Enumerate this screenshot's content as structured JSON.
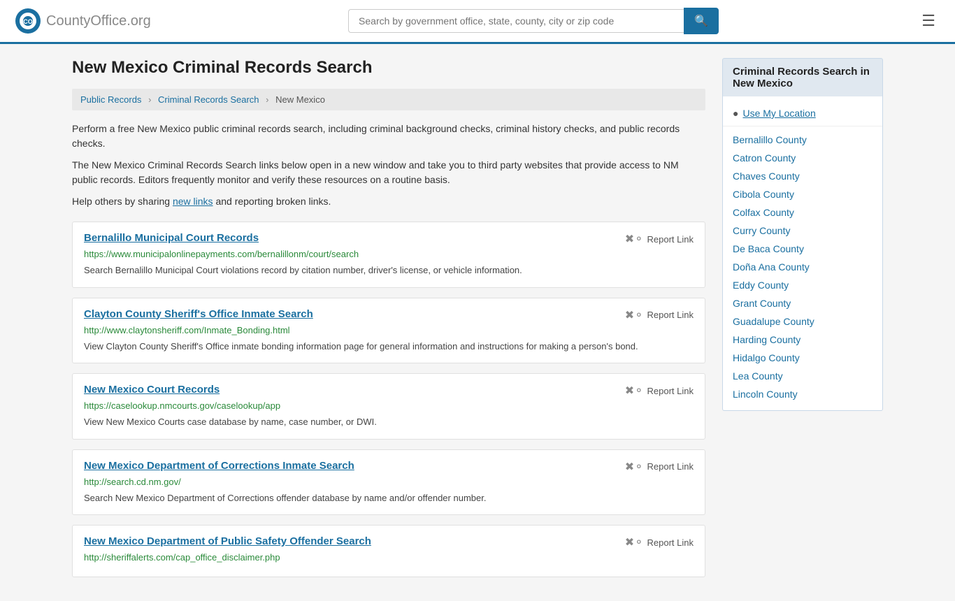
{
  "header": {
    "logo_text": "CountyOffice",
    "logo_suffix": ".org",
    "search_placeholder": "Search by government office, state, county, city or zip code",
    "search_value": ""
  },
  "page": {
    "title": "New Mexico Criminal Records Search",
    "breadcrumb": {
      "items": [
        "Public Records",
        "Criminal Records Search",
        "New Mexico"
      ]
    },
    "description1": "Perform a free New Mexico public criminal records search, including criminal background checks, criminal history checks, and public records checks.",
    "description2": "The New Mexico Criminal Records Search links below open in a new window and take you to third party websites that provide access to NM public records. Editors frequently monitor and verify these resources on a routine basis.",
    "description3_prefix": "Help others by sharing ",
    "description3_link": "new links",
    "description3_suffix": " and reporting broken links."
  },
  "records": [
    {
      "title": "Bernalillo Municipal Court Records",
      "url": "https://www.municipalonlinepayments.com/bernalillonm/court/search",
      "description": "Search Bernalillo Municipal Court violations record by citation number, driver's license, or vehicle information.",
      "report_label": "Report Link"
    },
    {
      "title": "Clayton County Sheriff's Office Inmate Search",
      "url": "http://www.claytonsheriff.com/Inmate_Bonding.html",
      "description": "View Clayton County Sheriff's Office inmate bonding information page for general information and instructions for making a person's bond.",
      "report_label": "Report Link"
    },
    {
      "title": "New Mexico Court Records",
      "url": "https://caselookup.nmcourts.gov/caselookup/app",
      "description": "View New Mexico Courts case database by name, case number, or DWI.",
      "report_label": "Report Link"
    },
    {
      "title": "New Mexico Department of Corrections Inmate Search",
      "url": "http://search.cd.nm.gov/",
      "description": "Search New Mexico Department of Corrections offender database by name and/or offender number.",
      "report_label": "Report Link"
    },
    {
      "title": "New Mexico Department of Public Safety Offender Search",
      "url": "http://sheriffalerts.com/cap_office_disclaimer.php",
      "description": "",
      "report_label": "Report Link"
    }
  ],
  "sidebar": {
    "title": "Criminal Records Search in New Mexico",
    "use_location_label": "Use My Location",
    "counties": [
      "Bernalillo County",
      "Catron County",
      "Chaves County",
      "Cibola County",
      "Colfax County",
      "Curry County",
      "De Baca County",
      "Doña Ana County",
      "Eddy County",
      "Grant County",
      "Guadalupe County",
      "Harding County",
      "Hidalgo County",
      "Lea County",
      "Lincoln County"
    ]
  }
}
